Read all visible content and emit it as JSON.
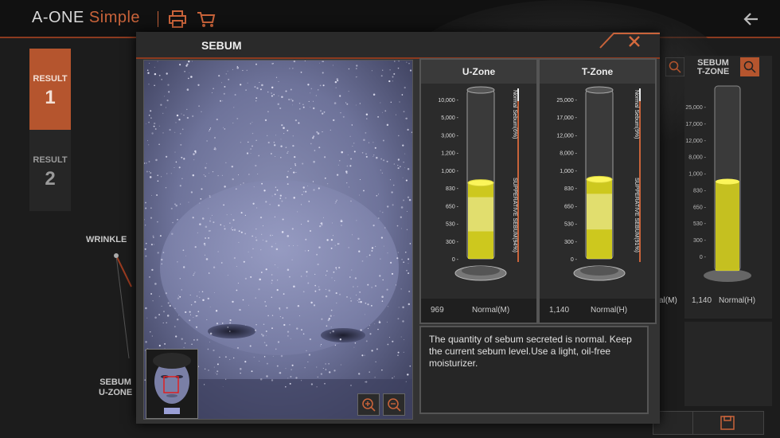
{
  "app": {
    "name": "A-ONE",
    "mode": "Simple"
  },
  "tabs": [
    {
      "label": "RESULT",
      "number": "1"
    },
    {
      "label": "RESULT",
      "number": "2"
    }
  ],
  "background": {
    "wrinkle_label": "WRINKLE",
    "sebum_uzone_label_1": "SEBUM",
    "sebum_uzone_label_2": "U-ZONE",
    "right_header_1": "SEBUM",
    "right_header_2": "T-ZONE",
    "right_scale": [
      "25,000 -",
      "17,000 -",
      "12,000 -",
      "8,000 -",
      "1,000 -",
      "830 -",
      "650 -",
      "530 -",
      "300 -",
      "0 -"
    ],
    "right_value": "1,140",
    "right_grade": "Normal(H)",
    "left_fragment": "al(M)"
  },
  "modal": {
    "title": "SEBUM",
    "zones": [
      {
        "name": "U-Zone",
        "scale": [
          "10,000 -",
          "5,000 -",
          "3,000 -",
          "1,200 -",
          "1,000 -",
          "830 -",
          "650 -",
          "530 -",
          "300 -",
          "0 -"
        ],
        "side_label_top": "Normal Sebum(6%)",
        "side_label_bottom": "SUPPERATIVE SEBUM(94%)",
        "value": "969",
        "grade": "Normal(M)",
        "fill_fraction": 0.45
      },
      {
        "name": "T-Zone",
        "scale": [
          "25,000 -",
          "17,000 -",
          "12,000 -",
          "8,000 -",
          "1,000 -",
          "830 -",
          "650 -",
          "530 -",
          "300 -",
          "0 -"
        ],
        "side_label_top": "Normal Sebum(9%)",
        "side_label_bottom": "SUPPERATIVE SEBUM(91%)",
        "value": "1,140",
        "grade": "Normal(H)",
        "fill_fraction": 0.47
      }
    ],
    "description": "The quantity of sebum secreted is normal. Keep the current sebum level.Use a light, oil-free moisturizer."
  },
  "colors": {
    "accent": "#c9633a",
    "sebum_fill": "#e8e21a",
    "panel": "#2b2b2b"
  },
  "icons": [
    "printer-icon",
    "cart-icon",
    "back-arrow-icon",
    "close-icon",
    "zoom-in-icon",
    "zoom-out-icon",
    "search-icon",
    "save-icon"
  ]
}
